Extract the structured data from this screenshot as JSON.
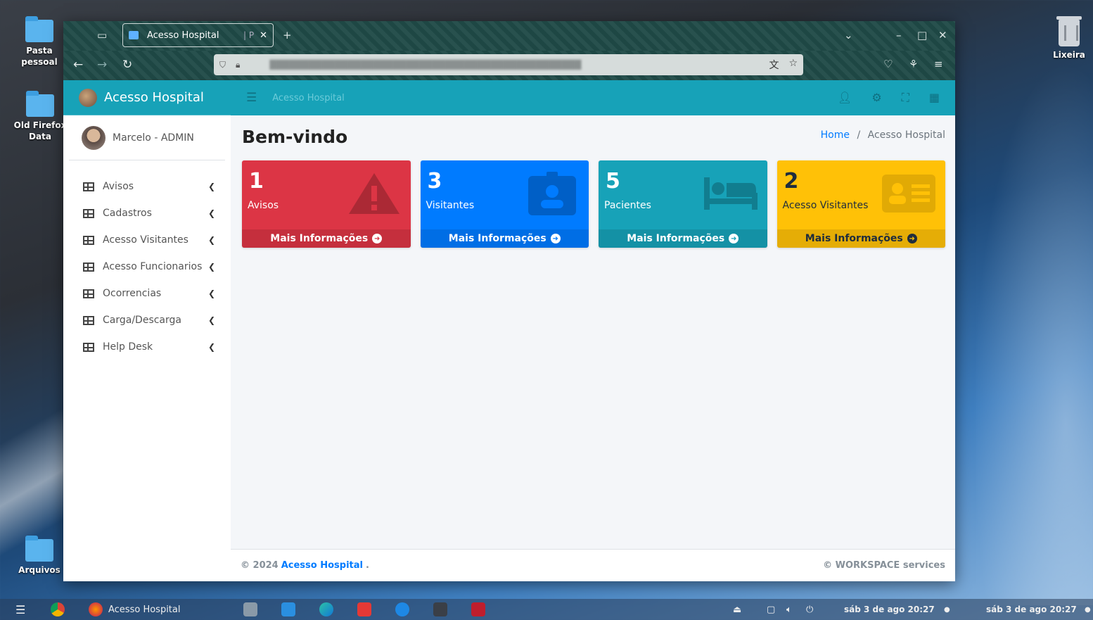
{
  "desktop": {
    "icons": [
      {
        "label": "Pasta pessoal"
      },
      {
        "label": "Old Firefox Data"
      },
      {
        "label": "Arquivos"
      },
      {
        "label": "Lixeira"
      }
    ]
  },
  "browser": {
    "tab_title": "Acesso Hospital",
    "tab_suffix": "| P"
  },
  "app": {
    "brand": "Acesso Hospital",
    "user": "Marcelo - ADMIN",
    "topnav_crumb": "Acesso Hospital",
    "menu": [
      {
        "label": "Avisos"
      },
      {
        "label": "Cadastros"
      },
      {
        "label": "Acesso Visitantes"
      },
      {
        "label": "Acesso Funcionarios"
      },
      {
        "label": "Ocorrencias"
      },
      {
        "label": "Carga/Descarga"
      },
      {
        "label": "Help Desk"
      }
    ],
    "page_title": "Bem-vindo",
    "breadcrumb": {
      "home": "Home",
      "sep": "/",
      "current": "Acesso Hospital"
    },
    "boxes": [
      {
        "value": "1",
        "label": "Avisos",
        "footer": "Mais Informações",
        "color": "#dc3545",
        "icon": "warning-icon"
      },
      {
        "value": "3",
        "label": "Visitantes",
        "footer": "Mais Informações",
        "color": "#007bff",
        "icon": "id-badge-icon"
      },
      {
        "value": "5",
        "label": "Pacientes",
        "footer": "Mais Informações",
        "color": "#17a2b8",
        "icon": "bed-icon"
      },
      {
        "value": "2",
        "label": "Acesso Visitantes",
        "footer": "Mais Informações",
        "color": "#ffc107",
        "icon": "id-card-icon"
      }
    ],
    "footer": {
      "left_prefix": "© 2024",
      "left_link": "Acesso Hospital",
      "left_suffix": ".",
      "right": "© WORKSPACE services"
    }
  },
  "taskbar": {
    "active_window": "Acesso Hospital",
    "clock1": "sáb 3 de ago  20:27",
    "clock2": "sáb 3 de ago  20:27"
  }
}
